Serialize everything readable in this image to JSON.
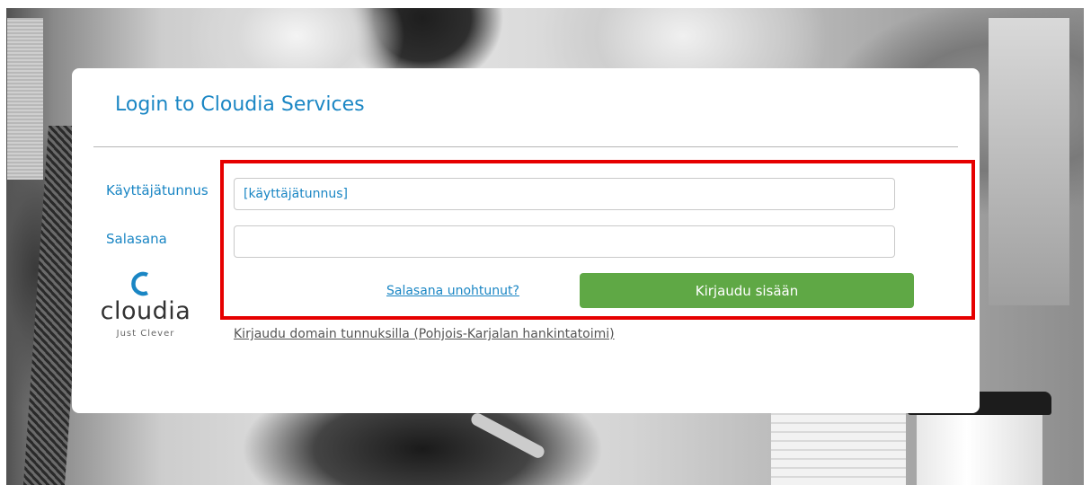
{
  "login": {
    "title": "Login to Cloudia Services",
    "username_label": "Käyttäjätunnus",
    "username_value": "[käyttäjätunnus]",
    "password_label": "Salasana",
    "password_value": "",
    "forgot_link": "Salasana unohtunut?",
    "login_button": "Kirjaudu sisään",
    "domain_link": "Kirjaudu domain tunnuksilla (Pohjois-Karjalan hankintatoimi)"
  },
  "logo": {
    "wordmark": "cloudia",
    "tagline": "Just Clever"
  },
  "colors": {
    "accent": "#1a86c4",
    "button": "#5fa845",
    "highlight": "#e60000"
  }
}
